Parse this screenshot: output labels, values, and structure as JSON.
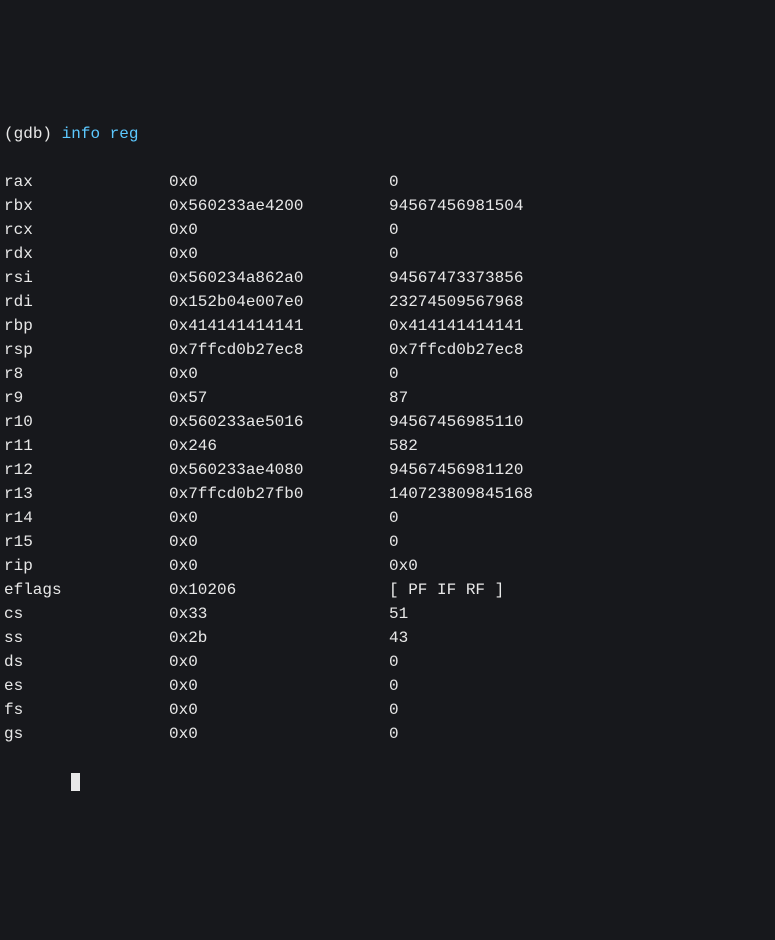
{
  "prompt": {
    "open": "(",
    "gdb": "gdb",
    "close": ")",
    "command": "info reg"
  },
  "registers": [
    {
      "name": "rax",
      "hex": "0x0",
      "dec": "0"
    },
    {
      "name": "rbx",
      "hex": "0x560233ae4200",
      "dec": "94567456981504"
    },
    {
      "name": "rcx",
      "hex": "0x0",
      "dec": "0"
    },
    {
      "name": "rdx",
      "hex": "0x0",
      "dec": "0"
    },
    {
      "name": "rsi",
      "hex": "0x560234a862a0",
      "dec": "94567473373856"
    },
    {
      "name": "rdi",
      "hex": "0x152b04e007e0",
      "dec": "23274509567968"
    },
    {
      "name": "rbp",
      "hex": "0x414141414141",
      "dec": "0x414141414141"
    },
    {
      "name": "rsp",
      "hex": "0x7ffcd0b27ec8",
      "dec": "0x7ffcd0b27ec8"
    },
    {
      "name": "r8",
      "hex": "0x0",
      "dec": "0"
    },
    {
      "name": "r9",
      "hex": "0x57",
      "dec": "87"
    },
    {
      "name": "r10",
      "hex": "0x560233ae5016",
      "dec": "94567456985110"
    },
    {
      "name": "r11",
      "hex": "0x246",
      "dec": "582"
    },
    {
      "name": "r12",
      "hex": "0x560233ae4080",
      "dec": "94567456981120"
    },
    {
      "name": "r13",
      "hex": "0x7ffcd0b27fb0",
      "dec": "140723809845168"
    },
    {
      "name": "r14",
      "hex": "0x0",
      "dec": "0"
    },
    {
      "name": "r15",
      "hex": "0x0",
      "dec": "0"
    },
    {
      "name": "rip",
      "hex": "0x0",
      "dec": "0x0"
    },
    {
      "name": "eflags",
      "hex": "0x10206",
      "dec": "[ PF IF RF ]"
    },
    {
      "name": "cs",
      "hex": "0x33",
      "dec": "51"
    },
    {
      "name": "ss",
      "hex": "0x2b",
      "dec": "43"
    },
    {
      "name": "ds",
      "hex": "0x0",
      "dec": "0"
    },
    {
      "name": "es",
      "hex": "0x0",
      "dec": "0"
    },
    {
      "name": "fs",
      "hex": "0x0",
      "dec": "0"
    },
    {
      "name": "gs",
      "hex": "0x0",
      "dec": "0"
    }
  ]
}
